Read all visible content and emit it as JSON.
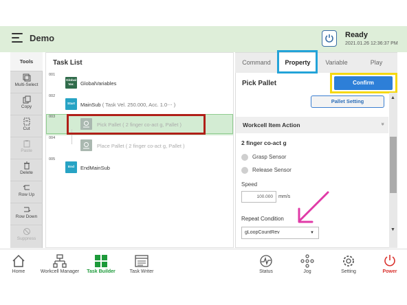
{
  "header": {
    "app_title": "Demo",
    "status_title": "Ready",
    "status_time": "2021.01.26 12:36:37 PM"
  },
  "tools": {
    "header": "Tools",
    "items": [
      {
        "label": "Multi-Select",
        "icon": "multi-select-icon",
        "enabled": true
      },
      {
        "label": "Copy",
        "icon": "copy-icon",
        "enabled": true
      },
      {
        "label": "Cut",
        "icon": "cut-icon",
        "enabled": true
      },
      {
        "label": "Paste",
        "icon": "paste-icon",
        "enabled": false
      },
      {
        "label": "Delete",
        "icon": "trash-icon",
        "enabled": true
      },
      {
        "label": "Row Up",
        "icon": "row-up-icon",
        "enabled": true
      },
      {
        "label": "Row Down",
        "icon": "row-down-icon",
        "enabled": true
      },
      {
        "label": "Suppress",
        "icon": "suppress-icon",
        "enabled": false
      }
    ]
  },
  "tasklist": {
    "title": "Task List",
    "rows": [
      {
        "num": "001",
        "icon_text": "Global Var.",
        "name": "GlobalVariables",
        "param": ""
      },
      {
        "num": "002",
        "icon_text": "Start",
        "name": "MainSub",
        "param": "( Task Vel. 250.000, Acc. 1.0⋯ )"
      },
      {
        "num": "003",
        "icon_text": "",
        "name": "Pick Pallet",
        "param": "( 2 finger co-act g, Pallet )"
      },
      {
        "num": "004",
        "icon_text": "",
        "name": "Place Pallet",
        "param": "( 2 finger co-act g, Pallet )"
      },
      {
        "num": "005",
        "icon_text": "End",
        "name": "EndMainSub",
        "param": ""
      }
    ]
  },
  "property": {
    "tabs": [
      "Command",
      "Property",
      "Variable",
      "Play"
    ],
    "active_tab": "Property",
    "title": "Pick Pallet",
    "confirm_label": "Confirm",
    "pallet_setting_label": "Pallet Setting",
    "section_title": "Workcell Item Action",
    "section_chevron": "»",
    "gripper_title": "2 finger co-act g",
    "grasp_label": "Grasp Sensor",
    "release_label": "Release Sensor",
    "speed_label": "Speed",
    "speed_value": "100.000",
    "speed_unit": "mm/s",
    "repeat_label": "Repeat Condition",
    "repeat_value": "gLoopCountRev",
    "scroll_up": "▲",
    "scroll_down": "▼",
    "select_caret": "▼"
  },
  "bottom_nav": [
    {
      "label": "Home",
      "icon": "home-icon"
    },
    {
      "label": "Workcell Manager",
      "icon": "workcell-manager-icon"
    },
    {
      "label": "Task Builder",
      "icon": "task-builder-icon",
      "active": true
    },
    {
      "label": "Task Writer",
      "icon": "task-writer-icon"
    },
    {
      "label": "Status",
      "icon": "status-chart-icon"
    },
    {
      "label": "Jog",
      "icon": "jog-icon"
    },
    {
      "label": "Setting",
      "icon": "gear-icon"
    },
    {
      "label": "Power",
      "icon": "power-icon"
    }
  ],
  "colors": {
    "header_bg": "#deeed9",
    "accent_blue": "#2d7fd8",
    "active_green": "#1d9a3a",
    "power_red": "#d9302c",
    "callout_red": "#b01f18",
    "callout_blue": "#23a3d8",
    "callout_yellow": "#f5d80f",
    "annotation_arrow": "#e03aa7"
  }
}
